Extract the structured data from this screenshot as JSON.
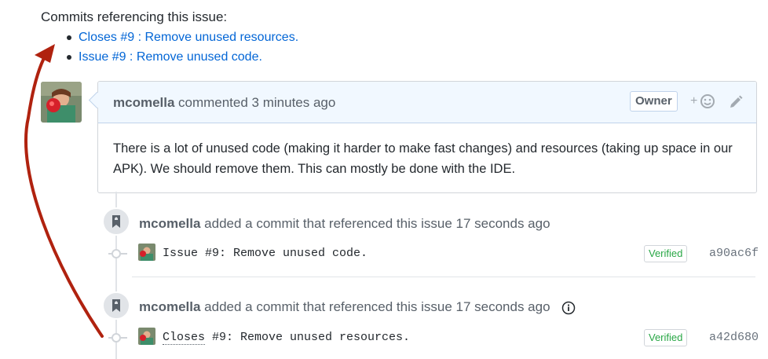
{
  "references": {
    "title": "Commits referencing this issue:",
    "items": [
      {
        "label": "Closes #9 : Remove unused resources."
      },
      {
        "label": "Issue #9 : Remove unused code."
      }
    ]
  },
  "comment": {
    "author": "mcomella",
    "meta": "commented 3 minutes ago",
    "badge": "Owner",
    "reaction_plus": "+",
    "body": "There is a lot of unused code (making it harder to make fast changes) and resources (taking up space in our APK). We should remove them. This can mostly be done with the IDE."
  },
  "timeline": [
    {
      "author": "mcomella",
      "text": "added a commit that referenced this issue 17 seconds ago",
      "commit_message": "Issue #9: Remove unused code.",
      "verified": "Verified",
      "sha": "a90ac6f"
    },
    {
      "author": "mcomella",
      "text": "added a commit that referenced this issue 17 seconds ago",
      "commit_prefix": "Closes",
      "commit_rest": " #9: Remove unused resources.",
      "verified": "Verified",
      "sha": "a42d680"
    }
  ],
  "colors": {
    "link": "#0366d6",
    "verified": "#28a745",
    "arrow": "#b0220f",
    "header_bg": "#f1f8ff"
  }
}
